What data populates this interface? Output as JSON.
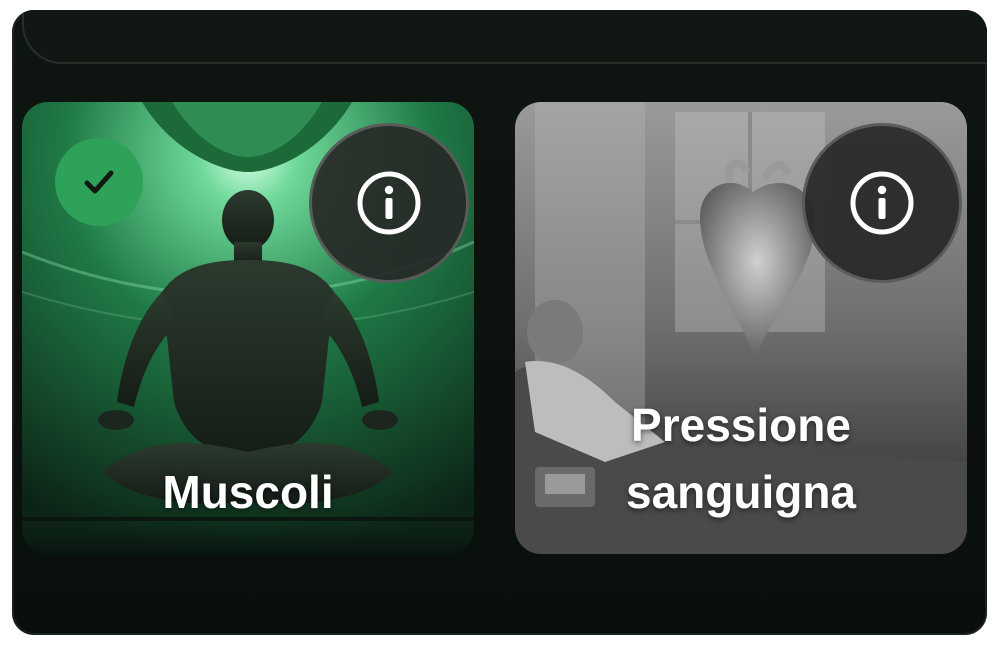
{
  "cards": [
    {
      "label": "Muscoli",
      "selected": true,
      "icons": {
        "selected": "checkmark-icon",
        "info": "info-icon"
      },
      "accent": "#2fa259"
    },
    {
      "label_lines": [
        "Pressione",
        "sanguigna"
      ],
      "selected": false,
      "icons": {
        "info": "info-icon"
      }
    }
  ]
}
